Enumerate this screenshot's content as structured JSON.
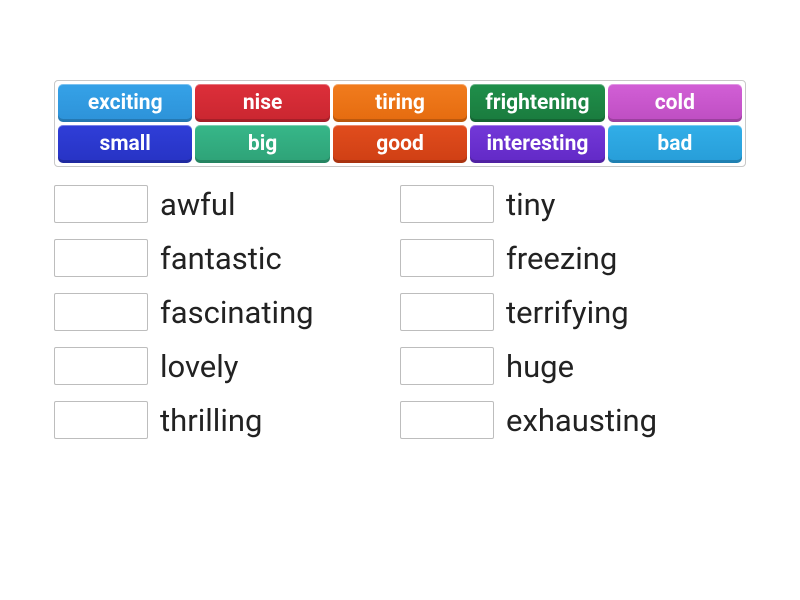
{
  "wordBank": {
    "rows": [
      [
        {
          "label": "exciting",
          "colorClass": "c-blue1"
        },
        {
          "label": "nise",
          "colorClass": "c-red"
        },
        {
          "label": "tiring",
          "colorClass": "c-orange"
        },
        {
          "label": "frightening",
          "colorClass": "c-green"
        },
        {
          "label": "cold",
          "colorClass": "c-magenta"
        }
      ],
      [
        {
          "label": "small",
          "colorClass": "c-blue2"
        },
        {
          "label": "big",
          "colorClass": "c-teal"
        },
        {
          "label": "good",
          "colorClass": "c-dorange"
        },
        {
          "label": "interesting",
          "colorClass": "c-purple"
        },
        {
          "label": "bad",
          "colorClass": "c-cyan"
        }
      ]
    ]
  },
  "targets": {
    "left": [
      {
        "label": "awful"
      },
      {
        "label": "fantastic"
      },
      {
        "label": "fascinating"
      },
      {
        "label": "lovely"
      },
      {
        "label": "thrilling"
      }
    ],
    "right": [
      {
        "label": "tiny"
      },
      {
        "label": "freezing"
      },
      {
        "label": "terrifying"
      },
      {
        "label": "huge"
      },
      {
        "label": "exhausting"
      }
    ]
  }
}
